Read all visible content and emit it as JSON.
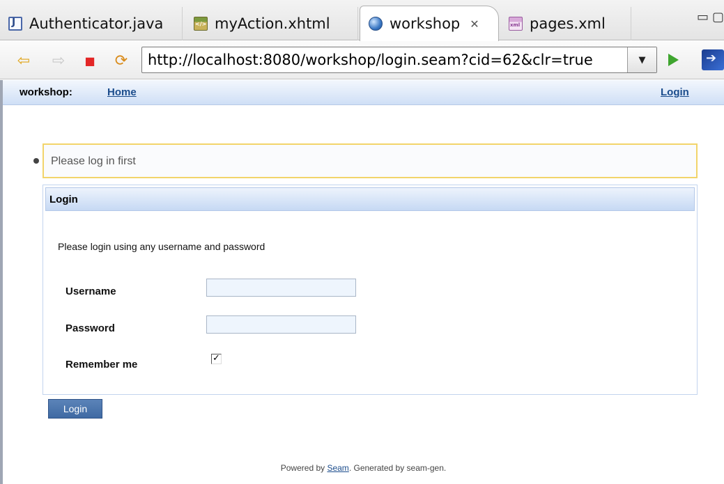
{
  "tabs": [
    {
      "label": "Authenticator.java",
      "icon": "java-file-icon"
    },
    {
      "label": "myAction.xhtml",
      "icon": "xhtml-file-icon"
    },
    {
      "label": "workshop",
      "icon": "browser-globe-icon",
      "active": true,
      "close": "✕"
    },
    {
      "label": "pages.xml",
      "icon": "xml-file-icon"
    }
  ],
  "window": {
    "minimize": "▭",
    "maximize": "▢"
  },
  "toolbar": {
    "back": "⇦",
    "forward": "⇨",
    "stop": "■",
    "refresh": "⟳",
    "url": "http://localhost:8080/workshop/login.seam?cid=62&clr=true",
    "dropdown": "▼"
  },
  "menu": {
    "brand": "workshop:",
    "home": "Home",
    "login": "Login"
  },
  "message": "Please log in first",
  "panel": {
    "title": "Login",
    "intro": "Please login using any username and password",
    "fields": [
      {
        "label": "Username",
        "value": ""
      },
      {
        "label": "Password",
        "value": ""
      },
      {
        "label": "Remember me",
        "checked": true
      }
    ],
    "check_mark": "✓"
  },
  "submit": "Login",
  "footer": {
    "prefix": "Powered by ",
    "link": "Seam",
    "suffix": ". Generated by seam-gen."
  },
  "colors": {
    "accent": "#1b4c8c",
    "message_border": "#f2d46a",
    "button": "#3f6aa3"
  }
}
